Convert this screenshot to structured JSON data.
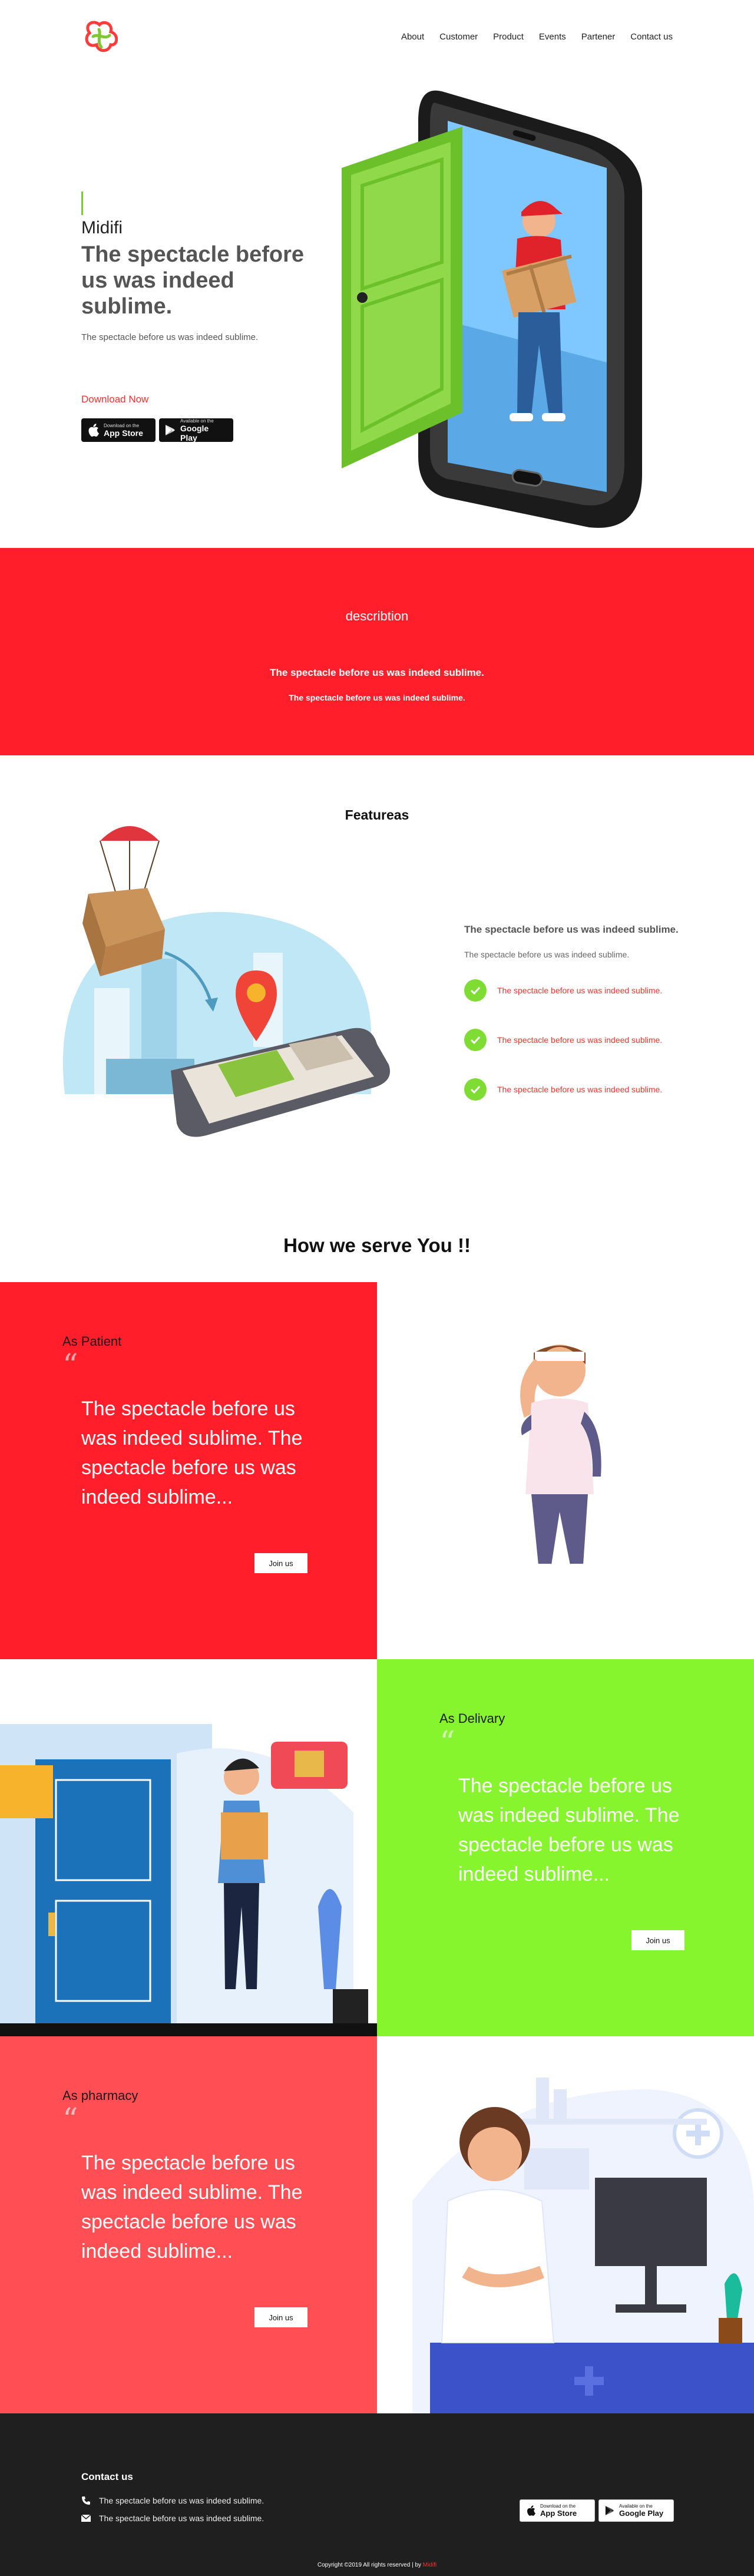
{
  "nav": {
    "items": [
      "About",
      "Customer",
      "Product",
      "Events",
      "Partener",
      "Contact us"
    ]
  },
  "hero": {
    "brand": "Midifi",
    "title": "The spectacle before us was indeed sublime.",
    "subtitle": "The spectacle before us was indeed sublime.",
    "download": "Download Now",
    "app_store_small": "Download on the",
    "app_store_big": "App Store",
    "google_play_small": "Available on the",
    "google_play_big": "Google Play"
  },
  "description": {
    "title": "describtion",
    "line1": "The spectacle before us was indeed sublime.",
    "line2": "The spectacle before us was indeed sublime."
  },
  "features": {
    "title": "Featureas",
    "heading": "The spectacle before us was indeed sublime.",
    "paragraph": "The spectacle before us was indeed sublime.",
    "items": [
      "The spectacle before us was indeed sublime.",
      "The spectacle before us was indeed sublime.",
      "The spectacle before us was indeed sublime."
    ]
  },
  "serve": {
    "title": "How we serve You !!"
  },
  "blocks": {
    "patient": {
      "label": "As Patient",
      "quote": "“",
      "text": "The spectacle before us was indeed sublime. The spectacle before us was indeed sublime...",
      "button": "Join us"
    },
    "delivery": {
      "label": "As Delivary",
      "quote": "“",
      "text": "The spectacle before us was indeed sublime. The spectacle before us was indeed sublime...",
      "button": "Join us"
    },
    "pharmacy": {
      "label": "As pharmacy",
      "quote": "“",
      "text": "The spectacle before us was indeed sublime. The spectacle before us was indeed sublime...",
      "button": "Join us"
    }
  },
  "footer": {
    "title": "Contact us",
    "phone": "The spectacle before us was indeed sublime.",
    "email": "The spectacle before us was indeed sublime.",
    "app_store_small": "Download on the",
    "app_store_big": "App Store",
    "google_play_small": "Available on the",
    "google_play_big": "Google Play",
    "copyright": "Copyright ©2019 All rights reserved | by ",
    "copyright_brand": "Midifi"
  },
  "colors": {
    "red": "#ff1e2a",
    "green": "#87f52e",
    "coral": "#ff4f54",
    "footer": "#1f1f1f",
    "accent_green": "#7ec832"
  }
}
